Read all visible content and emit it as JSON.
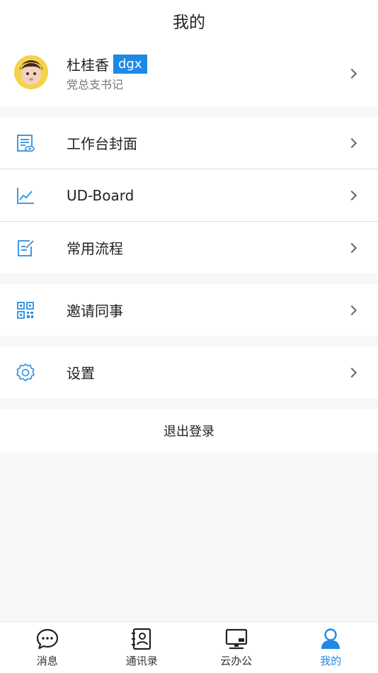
{
  "header": {
    "title": "我的"
  },
  "profile": {
    "name": "杜桂香",
    "tag": "dgx",
    "role": "党总支书记"
  },
  "menu": {
    "workbench_cover": "工作台封面",
    "ud_board": "UD-Board",
    "common_flows": "常用流程",
    "invite": "邀请同事",
    "settings": "设置"
  },
  "logout_label": "退出登录",
  "tabbar": {
    "items": [
      {
        "label": "消息",
        "icon": "chat-icon"
      },
      {
        "label": "通讯录",
        "icon": "contacts-icon"
      },
      {
        "label": "云办公",
        "icon": "desktop-icon"
      },
      {
        "label": "我的",
        "icon": "person-icon"
      }
    ],
    "active": 3
  },
  "colors": {
    "accent": "#1e88e5",
    "icon_blue": "#2b8fe0"
  }
}
